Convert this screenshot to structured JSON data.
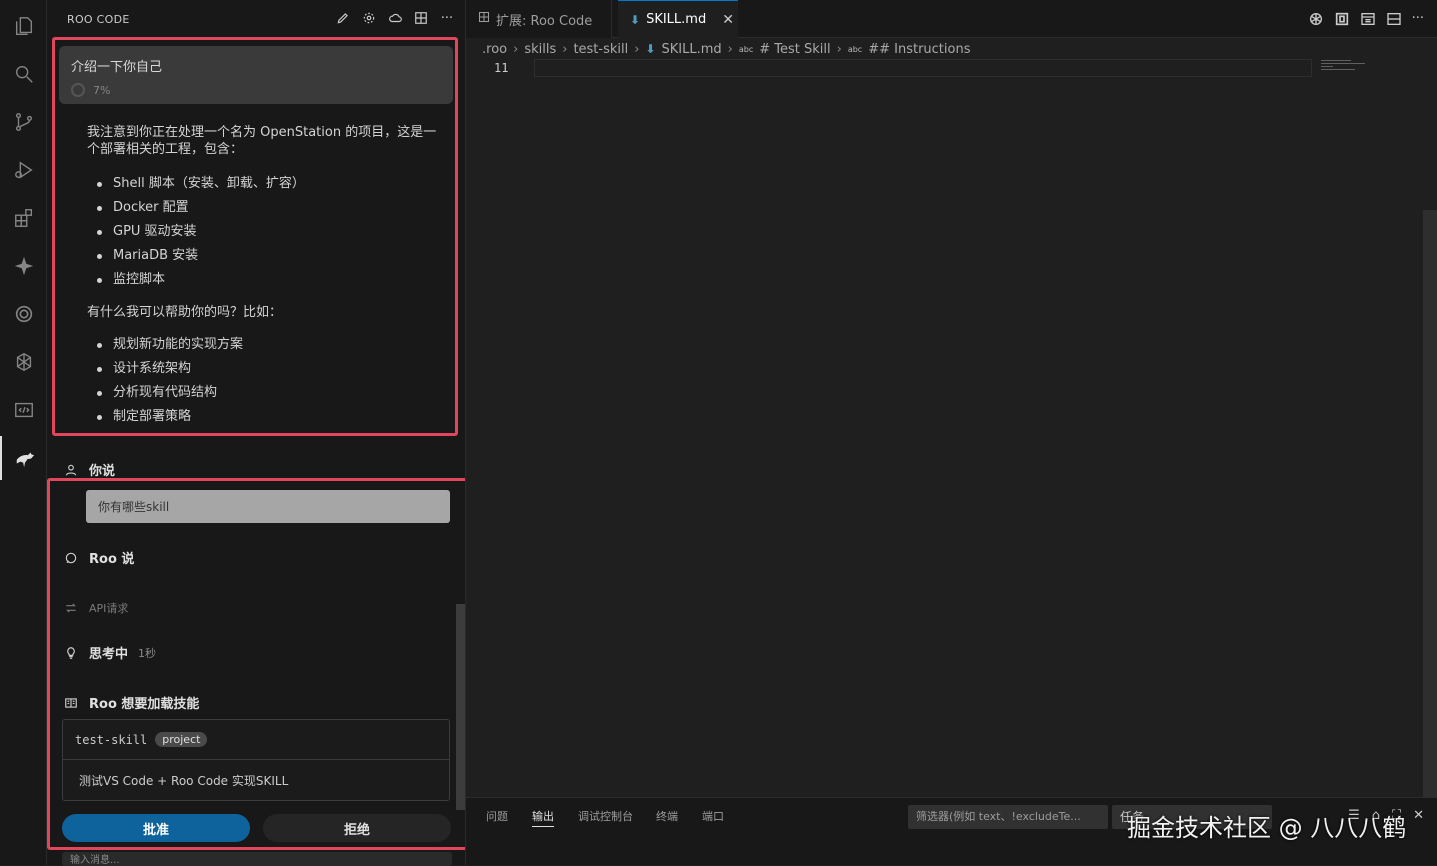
{
  "activity_bar": {
    "icons": [
      "explorer-icon",
      "search-icon",
      "source-control-icon",
      "run-debug-icon",
      "extensions-icon",
      "sparkle-icon",
      "openai-icon",
      "chatgpt-icon",
      "code-preview-icon",
      "roo-kangaroo-icon"
    ]
  },
  "sidebar": {
    "title": "ROO CODE",
    "task": {
      "title": "介绍一下你自己",
      "progress": "7%"
    },
    "assistant_message": {
      "intro": "我注意到你正在处理一个名为 OpenStation 的项目，这是一个部署相关的工程，包含：",
      "project_items": [
        "Shell 脚本（安装、卸载、扩容）",
        "Docker 配置",
        "GPU 驱动安装",
        "MariaDB 安装",
        "监控脚本"
      ],
      "question": "有什么我可以帮助你的吗？比如：",
      "help_items": [
        "规划新功能的实现方案",
        "设计系统架构",
        "分析现有代码结构",
        "制定部署策略"
      ]
    },
    "user_said_label": "你说",
    "user_message": "你有哪些skill",
    "roo_said_label": "Roo 说",
    "api_request_label": "API请求",
    "thinking_label": "思考中",
    "thinking_time": "1秒",
    "skill_request_label": "Roo 想要加载技能",
    "skill": {
      "name": "test-skill",
      "tag": "project",
      "description": "测试VS Code + Roo Code 实现SKILL"
    },
    "approve_label": "批准",
    "reject_label": "拒绝",
    "input_placeholder": "输入消息..."
  },
  "editor": {
    "tabs": [
      {
        "label": "扩展: Roo Code",
        "active": false
      },
      {
        "label": "SKILL.md",
        "active": true
      }
    ],
    "breadcrumbs": [
      ".roo",
      "skills",
      "test-skill",
      "SKILL.md",
      "# Test Skill",
      "## Instructions"
    ],
    "line_number": "11"
  },
  "panel": {
    "tabs": [
      "问题",
      "输出",
      "调试控制台",
      "终端",
      "端口"
    ],
    "active_tab": "输出",
    "filter_placeholder": "筛选器(例如 text、!excludeTe...",
    "task_select": "任务"
  },
  "watermark": "掘金技术社区 @ 八八八鹤",
  "colors": {
    "accent": "#0e639c",
    "highlight": "#e0465c",
    "background": "#1f1f1f"
  }
}
